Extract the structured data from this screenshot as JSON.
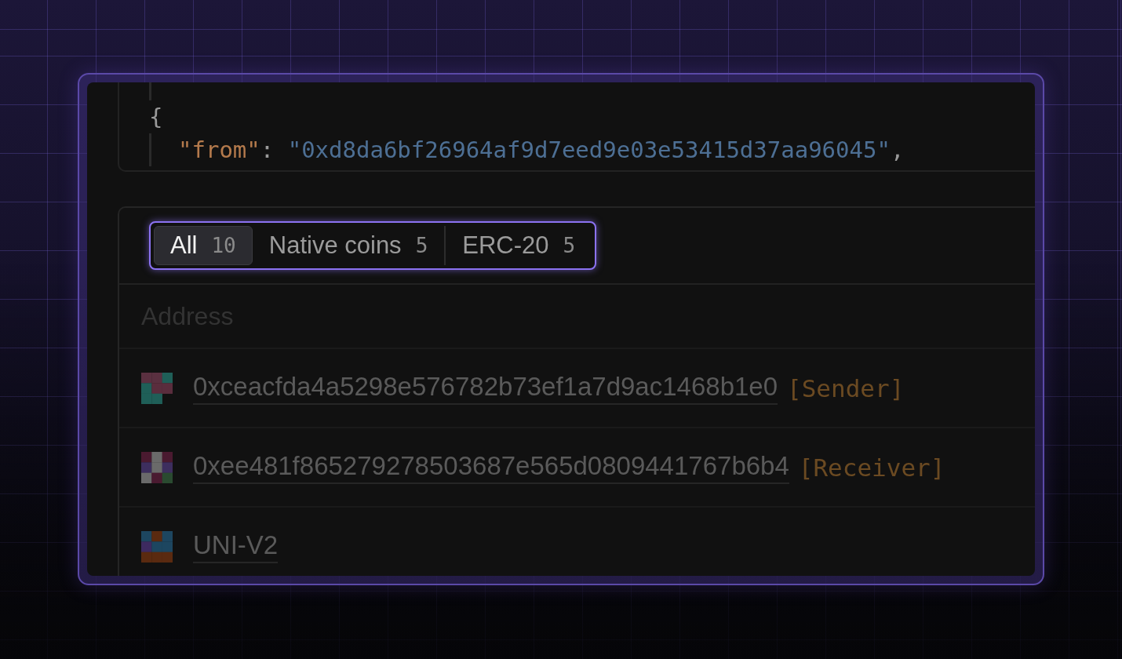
{
  "code": {
    "lines": [
      {
        "kind": "punct",
        "text": "{"
      },
      {
        "kind": "pair",
        "key": "\"from\"",
        "colon": ":",
        "value": "\"0xd8da6bf26964af9d7eed9e03e53415d37aa96045\"",
        "suffix": ","
      }
    ]
  },
  "tabs": [
    {
      "label": "All",
      "count": "10",
      "selected": true
    },
    {
      "label": "Native coins",
      "count": "5",
      "selected": false
    },
    {
      "label": "ERC-20",
      "count": "5",
      "selected": false
    }
  ],
  "table": {
    "columns": [
      "Address"
    ],
    "rows": [
      {
        "address": "0xceacfda4a5298e576782b73ef1a7d9ac1468b1e0",
        "tag": "[Sender]"
      },
      {
        "address": "0xee481f865279278503687e565d0809441767b6b4",
        "tag": "[Receiver]"
      },
      {
        "address": "UNI-V2"
      }
    ]
  }
}
